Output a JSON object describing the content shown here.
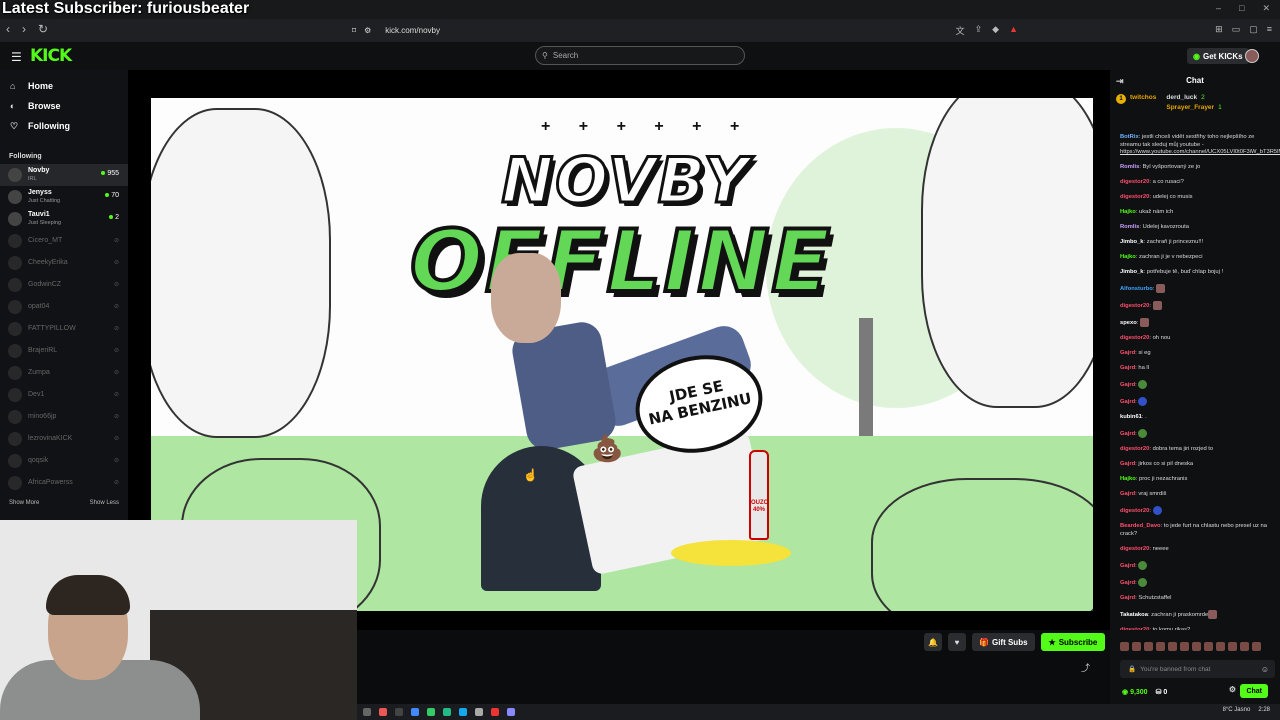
{
  "overlay": {
    "title": "Latest Subscriber: furiousbeater"
  },
  "browser": {
    "url": "kick.com/novby"
  },
  "header": {
    "logo": "KICK",
    "search_placeholder": "Search",
    "get_kicks": "Get KICKs"
  },
  "sidebar": {
    "nav": [
      {
        "label": "Home"
      },
      {
        "label": "Browse"
      },
      {
        "label": "Following"
      }
    ],
    "following_title": "Following",
    "channels": [
      {
        "name": "Novby",
        "sub": "IRL",
        "viewers": "955",
        "live": true
      },
      {
        "name": "Jenyss",
        "sub": "Just Chatting",
        "viewers": "70",
        "live": true
      },
      {
        "name": "Tauvi1",
        "sub": "Just Sleeping",
        "viewers": "2",
        "live": true
      },
      {
        "name": "Cicero_MT",
        "live": false
      },
      {
        "name": "CheekyErika",
        "live": false
      },
      {
        "name": "GodwinCZ",
        "live": false
      },
      {
        "name": "opat04",
        "live": false
      },
      {
        "name": "FATTYPILLOW",
        "live": false
      },
      {
        "name": "BrajeriRL",
        "live": false
      },
      {
        "name": "Zumpa",
        "live": false
      },
      {
        "name": "Dev1",
        "live": false
      },
      {
        "name": "mino66jp",
        "live": false
      },
      {
        "name": "lezrovinaKICK",
        "live": false
      },
      {
        "name": "qoqsik",
        "live": false
      },
      {
        "name": "AfricaPowerss",
        "live": false
      }
    ],
    "show_more": "Show More",
    "show_less": "Show Less"
  },
  "video": {
    "title_top": "NOVBY",
    "title_bottom": "OFFLINE",
    "bubble_line1": "JDE SE",
    "bubble_line2": "NA BENZINU",
    "plus_row": "+ + + + + +",
    "bottle_label": "OUZO 40%"
  },
  "controls": {
    "gift_subs": "Gift Subs",
    "subscribe": "Subscribe"
  },
  "chat": {
    "title": "Chat",
    "pinned": {
      "rank": "1",
      "user1": "twitchos",
      "user2": "derd_luck",
      "val2": "2",
      "user3": "Sprayer_Frayer",
      "val3": "1"
    },
    "messages": [
      {
        "user": "BotRix",
        "color": "#6fb3ff",
        "text": "jestli chceš vidět sestřihy toho nejlepšího ze streamu tak sleduj můj youtube -",
        "link": "https://www.youtube.com/channel/UCX05LVI0t0F3iW_bT3R5lMw"
      },
      {
        "user": "Romlis",
        "color": "#c9a0ff",
        "text": "Byl vyšportovaný ze jo"
      },
      {
        "user": "digestor20",
        "color": "#ff4f6e",
        "text": "a co rusaci?"
      },
      {
        "user": "digestor20",
        "color": "#ff4f6e",
        "text": "udelej co musis"
      },
      {
        "user": "Hajko",
        "color": "#53fc18",
        "text": "ukaž nám ich"
      },
      {
        "user": "Romlis",
        "color": "#c9a0ff",
        "text": "Udelej kavozrouta"
      },
      {
        "user": "Jimbo_k",
        "color": "#ffffff",
        "text": "zachraň ji princeznu!!!"
      },
      {
        "user": "Hajko",
        "color": "#53fc18",
        "text": "zachran ji je v nebezpeci"
      },
      {
        "user": "Jimbo_k",
        "color": "#ffffff",
        "text": "potřebuje tě, buď chlap bojuj !"
      },
      {
        "user": "Alfonsturbo",
        "color": "#3fa2ff",
        "text": "",
        "emote": "pic"
      },
      {
        "user": "digestor20",
        "color": "#ff4f6e",
        "text": "",
        "emote": "pic"
      },
      {
        "user": "spexo",
        "color": "#ffffff",
        "text": "",
        "emote": "pic"
      },
      {
        "user": "digestor20",
        "color": "#ff4f6e",
        "text": "oh nou"
      },
      {
        "user": "Gajrd",
        "color": "#ff4f6e",
        "text": "si eg"
      },
      {
        "user": "Gajrd",
        "color": "#ff4f6e",
        "text": "ha ll"
      },
      {
        "user": "Gajrd",
        "color": "#ff4f6e",
        "text": "",
        "emote": "green"
      },
      {
        "user": "Gajrd",
        "color": "#ff4f6e",
        "text": "",
        "emote": "blue"
      },
      {
        "user": "kubin61",
        "color": "#ffffff",
        "text": "."
      },
      {
        "user": "Gajrd",
        "color": "#ff4f6e",
        "text": "",
        "emote": "green"
      },
      {
        "user": "digestor20",
        "color": "#ff4f6e",
        "text": "dobra tema jiri rozjed to"
      },
      {
        "user": "Gajrd",
        "color": "#ff4f6e",
        "text": "jirkos co si pil dneska"
      },
      {
        "user": "Hajko",
        "color": "#53fc18",
        "text": "proc ji nezachranis"
      },
      {
        "user": "Gajrd",
        "color": "#ff4f6e",
        "text": "vraj smrdiš"
      },
      {
        "user": "digestor20",
        "color": "#ff4f6e",
        "text": "",
        "emote": "blue"
      },
      {
        "user": "Bearded_Davo",
        "color": "#ff4f6e",
        "text": "to jede furt na chlastu nebo presel uz na crack?"
      },
      {
        "user": "digestor20",
        "color": "#ff4f6e",
        "text": "neeee"
      },
      {
        "user": "Gajrd",
        "color": "#ff4f6e",
        "text": "",
        "emote": "green"
      },
      {
        "user": "Gajrd",
        "color": "#ff4f6e",
        "text": "",
        "emote": "green"
      },
      {
        "user": "Gajrd",
        "color": "#ff4f6e",
        "text": "Schutzstaffel"
      },
      {
        "user": "Takatakoa",
        "color": "#ffffff",
        "text": "zachran ji praskomrde",
        "emote": "pic"
      },
      {
        "user": "digestor20",
        "color": "#ff4f6e",
        "text": "to komu rikas?"
      }
    ],
    "banned_text": "You're banned from chat",
    "kicks_points": "9,300",
    "gifts": "0",
    "chat_button": "Chat"
  },
  "taskbar": {
    "weather": "8°C  Jasno",
    "time": "2:28"
  }
}
